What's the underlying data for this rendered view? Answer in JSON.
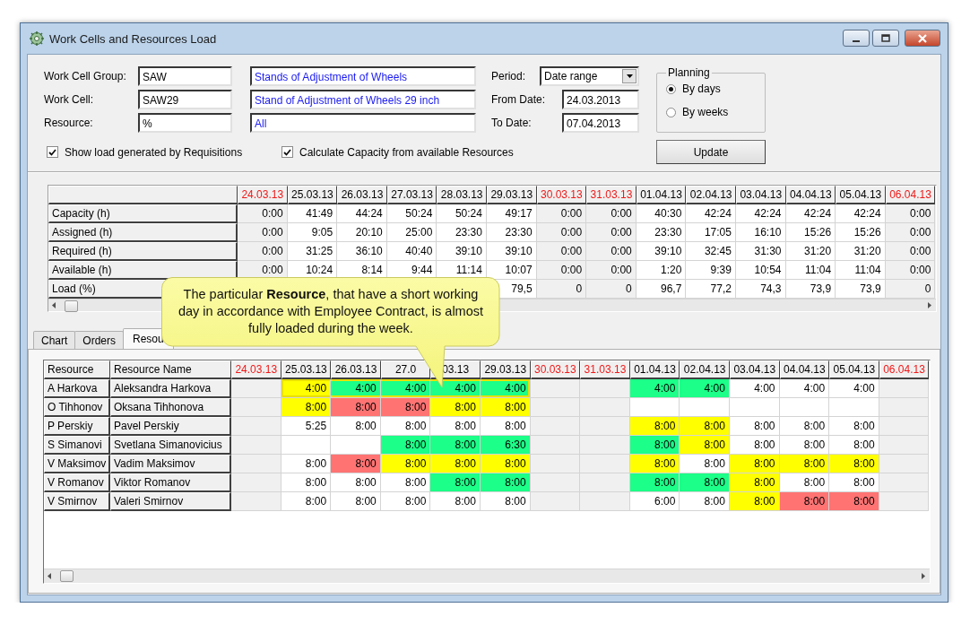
{
  "window": {
    "title": "Work Cells and Resources Load"
  },
  "form": {
    "fields": [
      {
        "label": "Work Cell Group:",
        "code": "SAW",
        "description": "Stands of Adjustment of Wheels"
      },
      {
        "label": "Work Cell:",
        "code": "SAW29",
        "description": "Stand of Adjustment of Wheels 29 inch"
      },
      {
        "label": "Resource:",
        "code": "%",
        "description": "All"
      }
    ],
    "checkboxes": [
      {
        "label": "Show load generated by Requisitions",
        "checked": true
      },
      {
        "label": "Calculate Capacity from available Resources",
        "checked": true
      }
    ],
    "period": {
      "label": "Period:",
      "value": "Date range"
    },
    "dates": [
      {
        "label": "From Date:",
        "value": "24.03.2013"
      },
      {
        "label": "To Date:",
        "value": "07.04.2013"
      }
    ],
    "planning": {
      "title": "Planning",
      "options": [
        {
          "label": "By days",
          "selected": true
        },
        {
          "label": "By weeks",
          "selected": false
        }
      ]
    },
    "update_button": "Update"
  },
  "summary_table": {
    "rows": [
      "Capacity (h)",
      "Assigned (h)",
      "Required (h)",
      "Available (h)",
      "Load (%)"
    ],
    "columns": [
      {
        "label": "24.03.13",
        "holiday": true,
        "values": [
          "0:00",
          "0:00",
          "0:00",
          "0:00"
        ]
      },
      {
        "label": "25.03.13",
        "holiday": false,
        "values": [
          "41:49",
          "9:05",
          "31:25",
          "10:24"
        ]
      },
      {
        "label": "26.03.13",
        "holiday": false,
        "values": [
          "44:24",
          "20:10",
          "36:10",
          "8:14"
        ]
      },
      {
        "label": "27.03.13",
        "holiday": false,
        "values": [
          "50:24",
          "25:00",
          "40:40",
          "9:44"
        ]
      },
      {
        "label": "28.03.13",
        "holiday": false,
        "values": [
          "50:24",
          "23:30",
          "39:10",
          "11:14"
        ]
      },
      {
        "label": "29.03.13",
        "holiday": false,
        "values": [
          "49:17",
          "23:30",
          "39:10",
          "10:07",
          "79,5"
        ]
      },
      {
        "label": "30.03.13",
        "holiday": true,
        "values": [
          "0:00",
          "0:00",
          "0:00",
          "0:00",
          "0"
        ]
      },
      {
        "label": "31.03.13",
        "holiday": true,
        "values": [
          "0:00",
          "0:00",
          "0:00",
          "0:00",
          "0"
        ]
      },
      {
        "label": "01.04.13",
        "holiday": false,
        "values": [
          "40:30",
          "23:30",
          "39:10",
          "1:20",
          "96,7"
        ]
      },
      {
        "label": "02.04.13",
        "holiday": false,
        "values": [
          "42:24",
          "17:05",
          "32:45",
          "9:39",
          "77,2"
        ]
      },
      {
        "label": "03.04.13",
        "holiday": false,
        "values": [
          "42:24",
          "16:10",
          "31:30",
          "10:54",
          "74,3"
        ]
      },
      {
        "label": "04.04.13",
        "holiday": false,
        "values": [
          "42:24",
          "15:26",
          "31:20",
          "11:04",
          "73,9"
        ]
      },
      {
        "label": "05.04.13",
        "holiday": false,
        "values": [
          "42:24",
          "15:26",
          "31:20",
          "11:04",
          "73,9"
        ]
      },
      {
        "label": "06.04.13",
        "holiday": true,
        "values": [
          "0:00",
          "0:00",
          "0:00",
          "0:00",
          "0"
        ]
      }
    ]
  },
  "tabs": [
    {
      "label": "Chart",
      "selected": false
    },
    {
      "label": "Orders",
      "selected": false
    },
    {
      "label": "Resou",
      "selected": true
    }
  ],
  "resource_table": {
    "columns": [
      "Resource",
      "Resource Name"
    ],
    "dates": [
      {
        "label": "24.03.13",
        "holiday": true
      },
      {
        "label": "25.03.13",
        "holiday": false
      },
      {
        "label": "26.03.13",
        "holiday": false
      },
      {
        "label": "27.0",
        "holiday": false
      },
      {
        "label": "03.13",
        "holiday": false
      },
      {
        "label": "29.03.13",
        "holiday": false
      },
      {
        "label": "30.03.13",
        "holiday": true
      },
      {
        "label": "31.03.13",
        "holiday": true
      },
      {
        "label": "01.04.13",
        "holiday": false
      },
      {
        "label": "02.04.13",
        "holiday": false
      },
      {
        "label": "03.04.13",
        "holiday": false
      },
      {
        "label": "04.04.13",
        "holiday": false
      },
      {
        "label": "05.04.13",
        "holiday": false
      },
      {
        "label": "06.04.13",
        "holiday": true
      }
    ],
    "rows": [
      {
        "resource": "A Harkova",
        "name": "Aleksandra Harkova",
        "cells": [
          null,
          {
            "text": "4:00",
            "color": "#ffff00",
            "highlighted": true
          },
          {
            "text": "4:00",
            "color": "#1cff88",
            "highlighted": true
          },
          {
            "text": "4:00",
            "color": "#1cff88",
            "highlighted": true
          },
          {
            "text": "4:00",
            "color": "#1cff88",
            "highlighted": true
          },
          {
            "text": "4:00",
            "color": "#1cff88",
            "highlighted": true
          },
          null,
          null,
          {
            "text": "4:00",
            "color": "#1cff88",
            "highlighted": false
          },
          {
            "text": "4:00",
            "color": "#1cff88",
            "highlighted": false
          },
          {
            "text": "4:00",
            "color": "#ffffff",
            "highlighted": false
          },
          {
            "text": "4:00",
            "color": "#ffffff",
            "highlighted": false
          },
          {
            "text": "4:00",
            "color": "#ffffff",
            "highlighted": false
          },
          null
        ]
      },
      {
        "resource": "O Tihhonov",
        "name": "Oksana Tihhonova",
        "cells": [
          null,
          {
            "text": "8:00",
            "color": "#ffff00",
            "highlighted": false
          },
          {
            "text": "8:00",
            "color": "#ff7373",
            "highlighted": false
          },
          {
            "text": "8:00",
            "color": "#ff7373",
            "highlighted": false
          },
          {
            "text": "8:00",
            "color": "#ffff00",
            "highlighted": false
          },
          {
            "text": "8:00",
            "color": "#ffff00",
            "highlighted": false
          },
          null,
          null,
          {
            "color": "#ffffff",
            "highlighted": false
          },
          {
            "color": "#ffffff",
            "highlighted": false
          },
          {
            "color": "#ffffff",
            "highlighted": false
          },
          {
            "color": "#ffffff",
            "highlighted": false
          },
          {
            "color": "#ffffff",
            "highlighted": false
          },
          null
        ]
      },
      {
        "resource": "P Perskiy",
        "name": "Pavel Perskiy",
        "cells": [
          null,
          {
            "text": "5:25",
            "color": "#ffffff",
            "highlighted": false
          },
          {
            "text": "8:00",
            "color": "#ffffff",
            "highlighted": false
          },
          {
            "text": "8:00",
            "color": "#ffffff",
            "highlighted": false
          },
          {
            "text": "8:00",
            "color": "#ffffff",
            "highlighted": false
          },
          {
            "text": "8:00",
            "color": "#ffffff",
            "highlighted": false
          },
          null,
          null,
          {
            "text": "8:00",
            "color": "#ffff00",
            "highlighted": false
          },
          {
            "text": "8:00",
            "color": "#ffff00",
            "highlighted": false
          },
          {
            "text": "8:00",
            "color": "#ffffff",
            "highlighted": false
          },
          {
            "text": "8:00",
            "color": "#ffffff",
            "highlighted": false
          },
          {
            "text": "8:00",
            "color": "#ffffff",
            "highlighted": false
          },
          null
        ]
      },
      {
        "resource": "S Simanovi",
        "name": "Svetlana Simanovicius",
        "cells": [
          null,
          {
            "color": "#ffffff",
            "highlighted": false
          },
          {
            "color": "#ffffff",
            "highlighted": false
          },
          {
            "text": "8:00",
            "color": "#1cff88",
            "highlighted": false
          },
          {
            "text": "8:00",
            "color": "#1cff88",
            "highlighted": false
          },
          {
            "text": "6:30",
            "color": "#1cff88",
            "highlighted": false
          },
          null,
          null,
          {
            "text": "8:00",
            "color": "#1cff88",
            "highlighted": false
          },
          {
            "text": "8:00",
            "color": "#ffff00",
            "highlighted": false
          },
          {
            "text": "8:00",
            "color": "#ffffff",
            "highlighted": false
          },
          {
            "text": "8:00",
            "color": "#ffffff",
            "highlighted": false
          },
          {
            "text": "8:00",
            "color": "#ffffff",
            "highlighted": false
          },
          null
        ]
      },
      {
        "resource": "V Maksimov",
        "name": "Vadim Maksimov",
        "cells": [
          null,
          {
            "text": "8:00",
            "color": "#ffffff",
            "highlighted": false
          },
          {
            "text": "8:00",
            "color": "#ff7373",
            "highlighted": false
          },
          {
            "text": "8:00",
            "color": "#ffff00",
            "highlighted": false
          },
          {
            "text": "8:00",
            "color": "#ffff00",
            "highlighted": false
          },
          {
            "text": "8:00",
            "color": "#ffff00",
            "highlighted": false
          },
          null,
          null,
          {
            "text": "8:00",
            "color": "#ffff00",
            "highlighted": false
          },
          {
            "text": "8:00",
            "color": "#ffffff",
            "highlighted": false
          },
          {
            "text": "8:00",
            "color": "#ffff00",
            "highlighted": false
          },
          {
            "text": "8:00",
            "color": "#ffff00",
            "highlighted": false
          },
          {
            "text": "8:00",
            "color": "#ffff00",
            "highlighted": false
          },
          null
        ]
      },
      {
        "resource": "V Romanov",
        "name": "Viktor Romanov",
        "cells": [
          null,
          {
            "text": "8:00",
            "color": "#ffffff",
            "highlighted": false
          },
          {
            "text": "8:00",
            "color": "#ffffff",
            "highlighted": false
          },
          {
            "text": "8:00",
            "color": "#ffffff",
            "highlighted": false
          },
          {
            "text": "8:00",
            "color": "#1cff88",
            "highlighted": false
          },
          {
            "text": "8:00",
            "color": "#1cff88",
            "highlighted": false
          },
          null,
          null,
          {
            "text": "8:00",
            "color": "#1cff88",
            "highlighted": false
          },
          {
            "text": "8:00",
            "color": "#1cff88",
            "highlighted": false
          },
          {
            "text": "8:00",
            "color": "#ffff00",
            "highlighted": false
          },
          {
            "text": "8:00",
            "color": "#ffffff",
            "highlighted": false
          },
          {
            "text": "8:00",
            "color": "#ffffff",
            "highlighted": false
          },
          null
        ]
      },
      {
        "resource": "V Smirnov",
        "name": "Valeri Smirnov",
        "cells": [
          null,
          {
            "text": "8:00",
            "color": "#ffffff",
            "highlighted": false
          },
          {
            "text": "8:00",
            "color": "#ffffff",
            "highlighted": false
          },
          {
            "text": "8:00",
            "color": "#ffffff",
            "highlighted": false
          },
          {
            "text": "8:00",
            "color": "#ffffff",
            "highlighted": false
          },
          {
            "text": "8:00",
            "color": "#ffffff",
            "highlighted": false
          },
          null,
          null,
          {
            "text": "6:00",
            "color": "#ffffff",
            "highlighted": false
          },
          {
            "text": "8:00",
            "color": "#ffffff",
            "highlighted": false
          },
          {
            "text": "8:00",
            "color": "#ffff00",
            "highlighted": false
          },
          {
            "text": "8:00",
            "color": "#ff7373",
            "highlighted": false
          },
          {
            "text": "8:00",
            "color": "#ff7373",
            "highlighted": false
          },
          null
        ]
      }
    ]
  },
  "callout": {
    "text": "The particular **Resource**, that have a short working day in accordance with Employee Contract, is almost fully loaded during the week."
  }
}
